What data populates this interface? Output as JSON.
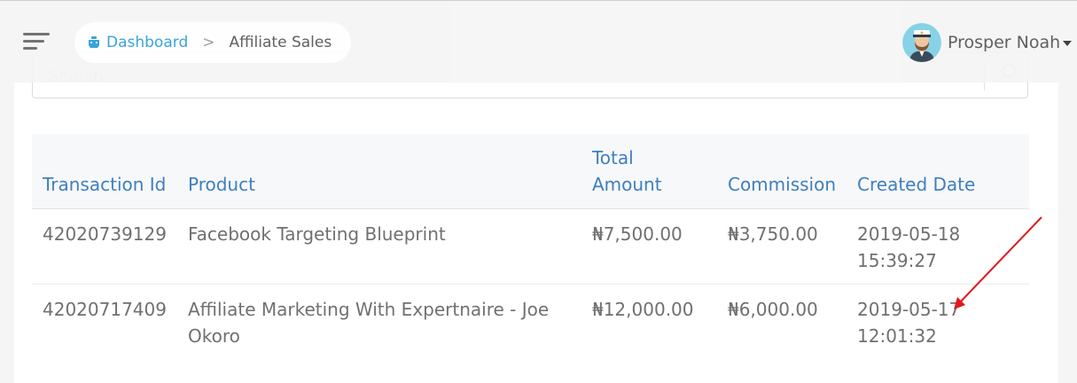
{
  "header": {
    "breadcrumb": {
      "home_label": "Dashboard",
      "separator": ">",
      "current_label": "Affiliate Sales"
    },
    "user": {
      "name": "Prosper Noah"
    }
  },
  "search": {
    "placeholder": "Search"
  },
  "table": {
    "columns": {
      "transaction_id": "Transaction Id",
      "product": "Product",
      "total_amount": "Total Amount",
      "commission": "Commission",
      "created_date": "Created Date"
    },
    "rows": [
      {
        "transaction_id": "42020739129",
        "product": "Facebook Targeting Blueprint",
        "total_amount": "₦7,500.00",
        "commission": "₦3,750.00",
        "created_date": "2019-05-18 15:39:27"
      },
      {
        "transaction_id": "42020717409",
        "product": "Affiliate Marketing With Expertnaire - Joe Okoro",
        "total_amount": "₦12,000.00",
        "commission": "₦6,000.00",
        "created_date": "2019-05-17 12:01:32"
      }
    ]
  },
  "colors": {
    "link": "#2a9fd8",
    "table_header_text": "#3f7fbf",
    "cell_text": "#707070",
    "annotation_arrow": "#e0191e"
  }
}
